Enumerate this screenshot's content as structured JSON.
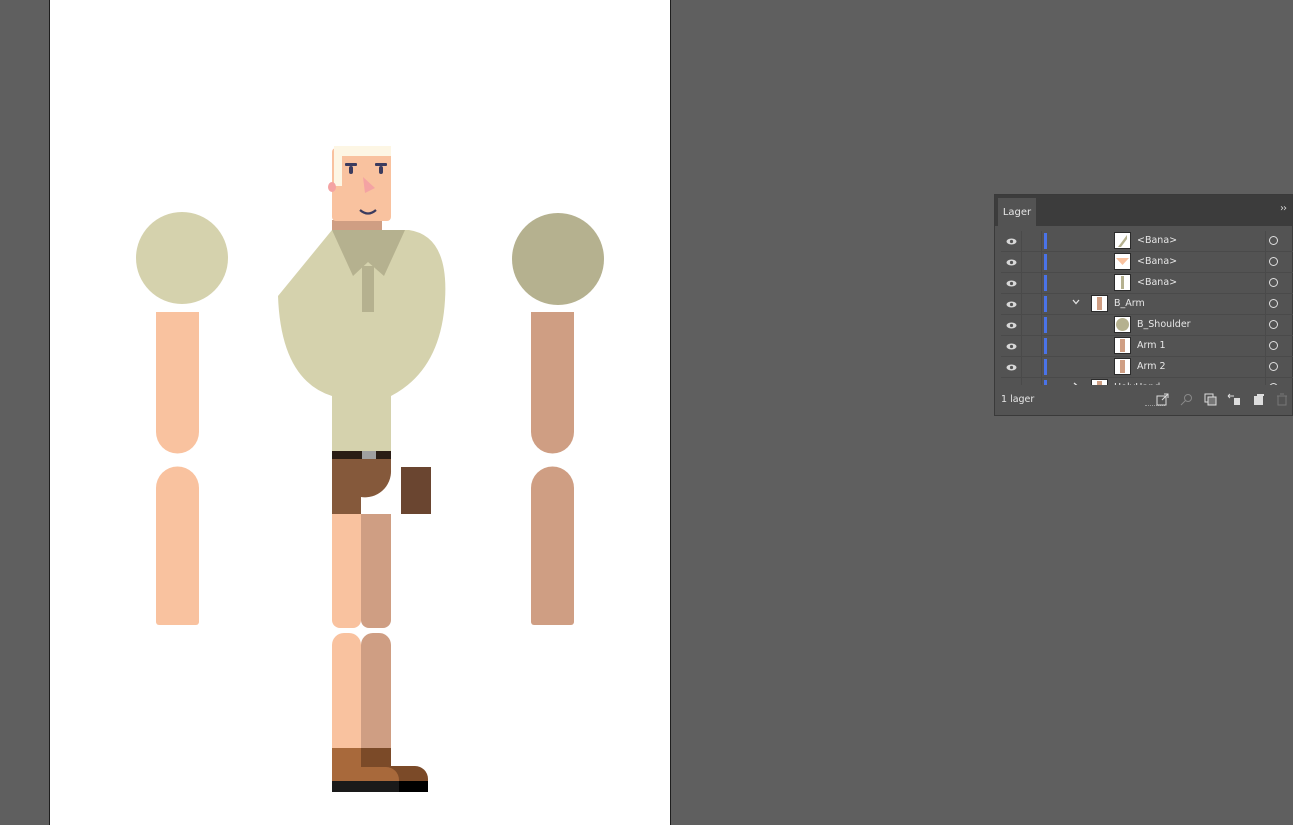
{
  "app": {
    "colors": {
      "canvas_bg": "#5f5f5f",
      "artboard": "#ffffff",
      "panel_bg": "#535353",
      "panel_header": "#3c3c3c",
      "layer_accent": "#4a73e8"
    }
  },
  "layers_panel": {
    "tab_label": "Lager",
    "menu_icon": "double-chevron-right-icon",
    "rows": [
      {
        "label": "<Bana>",
        "indent": 2,
        "expander": "",
        "thumb": "shape"
      },
      {
        "label": "<Bana>",
        "indent": 2,
        "expander": "",
        "thumb": "triangle"
      },
      {
        "label": "<Bana>",
        "indent": 2,
        "expander": "",
        "thumb": "bar"
      },
      {
        "label": "B_Arm",
        "indent": 1,
        "expander": "expanded",
        "thumb": "arm"
      },
      {
        "label": "B_Shoulder",
        "indent": 2,
        "expander": "",
        "thumb": "circle"
      },
      {
        "label": "Arm 1",
        "indent": 2,
        "expander": "",
        "thumb": "arm"
      },
      {
        "label": "Arm 2",
        "indent": 2,
        "expander": "",
        "thumb": "arm"
      },
      {
        "label": "HolyHand",
        "indent": 1,
        "expander": "collapsed",
        "thumb": "arm"
      }
    ],
    "footer": {
      "layer_count": "1 lager",
      "icons": [
        "export-icon",
        "search-icon",
        "clipping-mask-icon",
        "collect-icon",
        "new-sublayer-icon",
        "trash-icon"
      ]
    }
  },
  "artwork": {
    "colors": {
      "skin_light": "#f9c29f",
      "skin_dark": "#cf9e83",
      "shirt": "#d5d2ad",
      "shirt_dark": "#b5b18f",
      "hair": "#fdf6e4",
      "shorts": "#85593b",
      "shorts_dark": "#6a4530",
      "shoe": "#a8693b",
      "shoe_dark": "#7b4a28",
      "belt": "#2a1d15",
      "sole": "#1a1a1a"
    }
  }
}
